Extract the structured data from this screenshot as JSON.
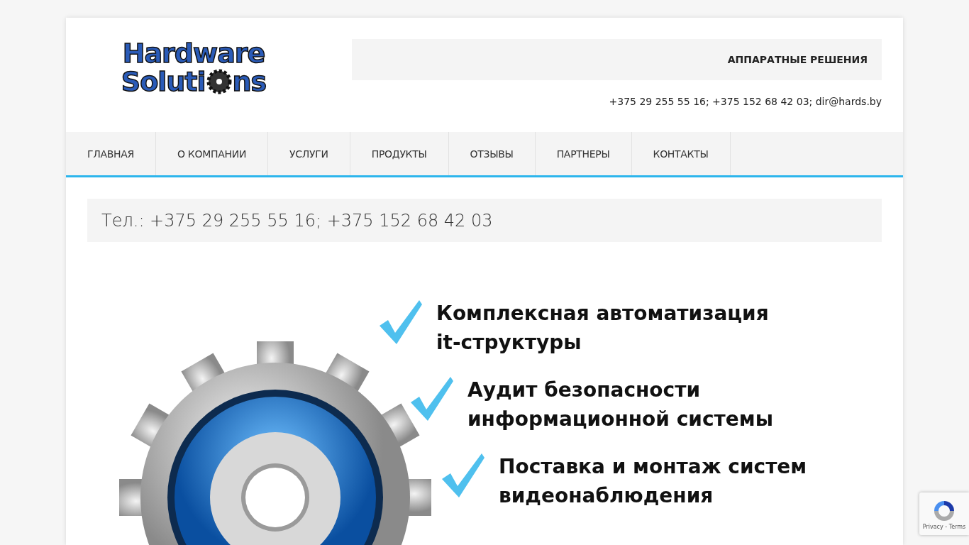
{
  "logo": {
    "line_1": "Hardware",
    "line_2_start": "Soluti",
    "line_2_end": "ns"
  },
  "header": {
    "tagline": "АППАРАТНЫЕ РЕШЕНИЯ",
    "contacts": "+375 29 255 55 16; +375 152 68 42 03; dir@hards.by"
  },
  "nav": [
    {
      "label": "ГЛАВНАЯ"
    },
    {
      "label": "О КОМПАНИИ"
    },
    {
      "label": "УСЛУГИ"
    },
    {
      "label": "ПРОДУКТЫ"
    },
    {
      "label": "ОТЗЫВЫ"
    },
    {
      "label": "ПАРТНЕРЫ"
    },
    {
      "label": "КОНТАКТЫ"
    }
  ],
  "phone_bar": "Тел.: +375 29 255 55 16; +375 152 68 42 03",
  "banner": {
    "items": [
      {
        "lines": [
          "Комплексная автоматизация",
          "it-структуры"
        ]
      },
      {
        "lines": [
          "Аудит безопасности",
          "информационной системы"
        ]
      },
      {
        "lines": [
          "Поставка и монтаж систем",
          "видеонаблюдения"
        ]
      }
    ]
  },
  "recaptcha": {
    "links": "Privacy - Terms"
  }
}
